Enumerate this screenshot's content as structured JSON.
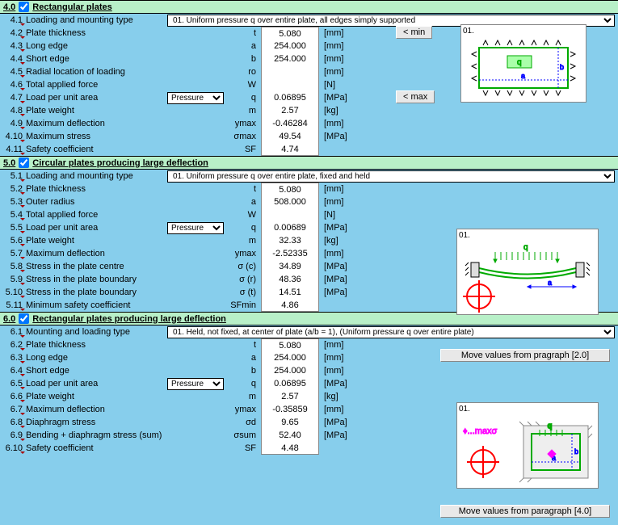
{
  "sections": {
    "s4": {
      "num": "4.0",
      "checked": true,
      "title": "Rectangular plates",
      "dropdown_row": {
        "num": "4.1",
        "label": "Loading and mounting type",
        "value": "01. Uniform pressure q over entire plate, all edges simply supported"
      },
      "rows": [
        {
          "num": "4.2",
          "label": "Plate thickness",
          "sym": "t",
          "val": "5.080",
          "unit": "[mm]"
        },
        {
          "num": "4.3",
          "label": "Long edge",
          "sym": "a",
          "val": "254.000",
          "unit": "[mm]"
        },
        {
          "num": "4.4",
          "label": "Short edge",
          "sym": "b",
          "val": "254.000",
          "unit": "[mm]"
        },
        {
          "num": "4.5",
          "label": "Radial location of loading",
          "sym": "ro",
          "val": "",
          "unit": "[mm]"
        },
        {
          "num": "4.6",
          "label": "Total applied force",
          "sym": "W",
          "val": "",
          "unit": "[N]"
        },
        {
          "num": "4.7",
          "label": "Load per unit area",
          "dd": "Pressure",
          "sym": "q",
          "val": "0.06895",
          "unit": "[MPa]"
        },
        {
          "num": "4.8",
          "label": "Plate weight",
          "sym": "m",
          "val": "2.57",
          "unit": "[kg]"
        },
        {
          "num": "4.9",
          "label": "Maximum deflection",
          "sym": "ymax",
          "val": "-0.46284",
          "unit": "[mm]"
        },
        {
          "num": "4.10",
          "label": "Maximum stress",
          "sym": "σmax",
          "val": "49.54",
          "unit": "[MPa]"
        },
        {
          "num": "4.11",
          "label": "Safety coefficient",
          "sym": "SF",
          "val": "4.74",
          "unit": ""
        }
      ],
      "btn_min": "< min",
      "btn_max": "< max",
      "diagram_label": "01."
    },
    "s5": {
      "num": "5.0",
      "checked": true,
      "title": "Circular plates producing large deflection",
      "dropdown_row": {
        "num": "5.1",
        "label": "Loading and mounting type",
        "value": "01. Uniform pressure q over entire plate, fixed and held"
      },
      "rows": [
        {
          "num": "5.2",
          "label": "Plate thickness",
          "sym": "t",
          "val": "5.080",
          "unit": "[mm]"
        },
        {
          "num": "5.3",
          "label": "Outer radius",
          "sym": "a",
          "val": "508.000",
          "unit": "[mm]"
        },
        {
          "num": "5.4",
          "label": "Total applied force",
          "sym": "W",
          "val": "",
          "unit": "[N]"
        },
        {
          "num": "5.5",
          "label": "Load per unit area",
          "dd": "Pressure",
          "sym": "q",
          "val": "0.00689",
          "unit": "[MPa]"
        },
        {
          "num": "5.6",
          "label": "Plate weight",
          "sym": "m",
          "val": "32.33",
          "unit": "[kg]"
        },
        {
          "num": "5.7",
          "label": "Maximum deflection",
          "sym": "ymax",
          "val": "-2.52335",
          "unit": "[mm]"
        },
        {
          "num": "5.8",
          "label": "Stress in the plate centre",
          "sym": "σ (c)",
          "val": "34.89",
          "unit": "[MPa]"
        },
        {
          "num": "5.9",
          "label": "Stress in the plate boundary",
          "sym": "σ (r)",
          "val": "48.36",
          "unit": "[MPa]"
        },
        {
          "num": "5.10",
          "label": "Stress in the plate boundary",
          "sym": "σ (t)",
          "val": "14.51",
          "unit": "[MPa]"
        },
        {
          "num": "5.11",
          "label": "Minimum safety coefficient",
          "sym": "SFmin",
          "val": "4.86",
          "unit": ""
        }
      ],
      "diagram_label": "01.",
      "move_btn": "Move values from pragraph [2.0]"
    },
    "s6": {
      "num": "6.0",
      "checked": true,
      "title": "Rectangular plates producing large deflection",
      "dropdown_row": {
        "num": "6.1",
        "label": "Mounting and loading type",
        "value": "01. Held, not fixed, at center of plate  (a/b = 1), (Uniform pressure q over entire plate)"
      },
      "rows": [
        {
          "num": "6.2",
          "label": "Plate thickness",
          "sym": "t",
          "val": "5.080",
          "unit": "[mm]"
        },
        {
          "num": "6.3",
          "label": "Long edge",
          "sym": "a",
          "val": "254.000",
          "unit": "[mm]"
        },
        {
          "num": "6.4",
          "label": "Short edge",
          "sym": "b",
          "val": "254.000",
          "unit": "[mm]"
        },
        {
          "num": "6.5",
          "label": "Load per unit area",
          "dd": "Pressure",
          "sym": "q",
          "val": "0.06895",
          "unit": "[MPa]"
        },
        {
          "num": "6.6",
          "label": "Plate weight",
          "sym": "m",
          "val": "2.57",
          "unit": "[kg]"
        },
        {
          "num": "6.7",
          "label": "Maximum deflection",
          "sym": "ymax",
          "val": "-0.35859",
          "unit": "[mm]"
        },
        {
          "num": "6.8",
          "label": "Diaphragm stress",
          "sym": "σd",
          "val": "9.65",
          "unit": "[MPa]"
        },
        {
          "num": "6.9",
          "label": "Bending + diaphragm stress (sum)",
          "sym": "σsum",
          "val": "52.40",
          "unit": "[MPa]"
        },
        {
          "num": "6.10",
          "label": "Safety coefficient",
          "sym": "SF",
          "val": "4.48",
          "unit": ""
        }
      ],
      "diagram_label": "01.",
      "move_btn": "Move values from paragraph [4.0]"
    }
  }
}
